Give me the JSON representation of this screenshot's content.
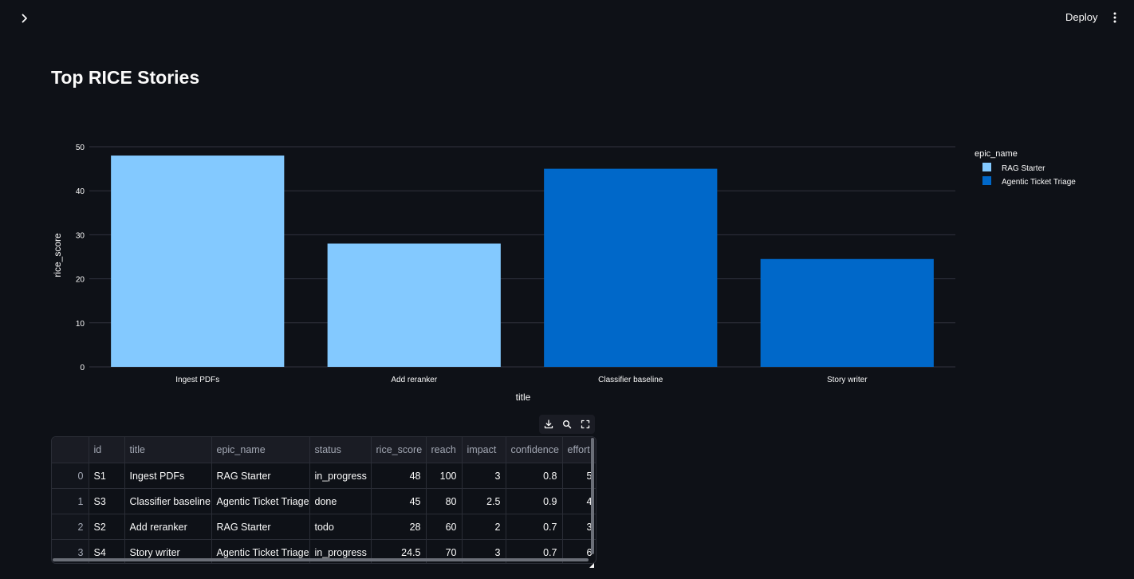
{
  "topbar": {
    "deploy_label": "Deploy"
  },
  "page": {
    "title": "Top RICE Stories"
  },
  "colors": {
    "background": "#0e1117",
    "rag_starter": "#83c9ff",
    "agentic_ticket_triage": "#0068c9",
    "gridline": "#31333f"
  },
  "chart_data": {
    "type": "bar",
    "categories": [
      "Ingest PDFs",
      "Add reranker",
      "Classifier baseline",
      "Story writer"
    ],
    "values": [
      48,
      28,
      45,
      24.5
    ],
    "series_of_category": [
      "RAG Starter",
      "RAG Starter",
      "Agentic Ticket Triage",
      "Agentic Ticket Triage"
    ],
    "xlabel": "title",
    "ylabel": "rice_score",
    "ylim": [
      0,
      50
    ],
    "yticks": [
      0,
      10,
      20,
      30,
      40,
      50
    ],
    "grid": true,
    "legend": {
      "title": "epic_name",
      "position": "top-right",
      "entries": [
        {
          "name": "RAG Starter",
          "color": "#83c9ff"
        },
        {
          "name": "Agentic Ticket Triage",
          "color": "#0068c9"
        }
      ]
    }
  },
  "table": {
    "toolbar_icons": [
      "download-icon",
      "search-icon",
      "fullscreen-icon"
    ],
    "columns": [
      "",
      "id",
      "title",
      "epic_name",
      "status",
      "rice_score",
      "reach",
      "impact",
      "confidence",
      "effort"
    ],
    "rows": [
      [
        "0",
        "S1",
        "Ingest PDFs",
        "RAG Starter",
        "in_progress",
        "48",
        "100",
        "3",
        "0.8",
        "5"
      ],
      [
        "1",
        "S3",
        "Classifier baseline",
        "Agentic Ticket Triage",
        "done",
        "45",
        "80",
        "2.5",
        "0.9",
        "4"
      ],
      [
        "2",
        "S2",
        "Add reranker",
        "RAG Starter",
        "todo",
        "28",
        "60",
        "2",
        "0.7",
        "3"
      ],
      [
        "3",
        "S4",
        "Story writer",
        "Agentic Ticket Triage",
        "in_progress",
        "24.5",
        "70",
        "3",
        "0.7",
        "6"
      ]
    ]
  }
}
